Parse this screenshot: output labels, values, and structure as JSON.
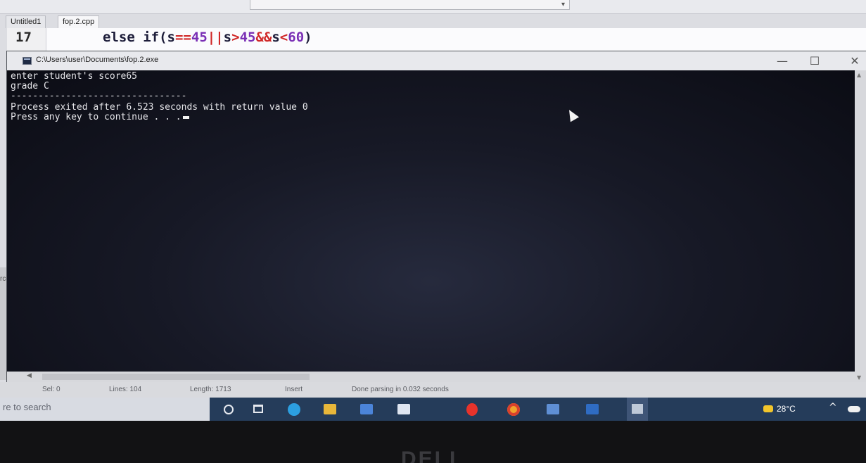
{
  "ide": {
    "tabs": [
      "Untitled1",
      "fop.2.cpp"
    ],
    "active_tab": "fop.2.cpp",
    "line_number": "17",
    "code": {
      "kw": "else if",
      "p1": "(",
      "v1": "s",
      "op1": "==",
      "n1": "45",
      "op2": "||",
      "v2": "s",
      "op3": ">",
      "n2": "45",
      "op4": "&&",
      "v3": "s",
      "op5": "<",
      "n3": "60",
      "p2": ")"
    },
    "side_text": "rce"
  },
  "console": {
    "title": "C:\\Users\\user\\Documents\\fop.2.exe",
    "lines": [
      "enter student's score65",
      "grade C",
      "--------------------------------",
      "Process exited after 6.523 seconds with return value 0",
      "Press any key to continue . . ."
    ],
    "window_buttons": {
      "minimize": "—",
      "maximize": "☐",
      "close": "✕"
    }
  },
  "status_bar": {
    "sel": "Sel: 0",
    "lines": "Lines: 104",
    "length": "Length: 1713",
    "mode": "Insert",
    "message": "Done parsing in 0.032 seconds"
  },
  "taskbar": {
    "search_placeholder": "re to search",
    "weather": "28°C",
    "tray_chevron": "^",
    "icons": [
      "cortana-icon",
      "task-view-icon",
      "edge-icon",
      "file-explorer-icon",
      "store-icon",
      "mail-icon",
      "opera-icon",
      "chrome-icon",
      "app-icon",
      "word-icon",
      "active-app-icon"
    ]
  },
  "bezel": {
    "brand": "DELL"
  }
}
